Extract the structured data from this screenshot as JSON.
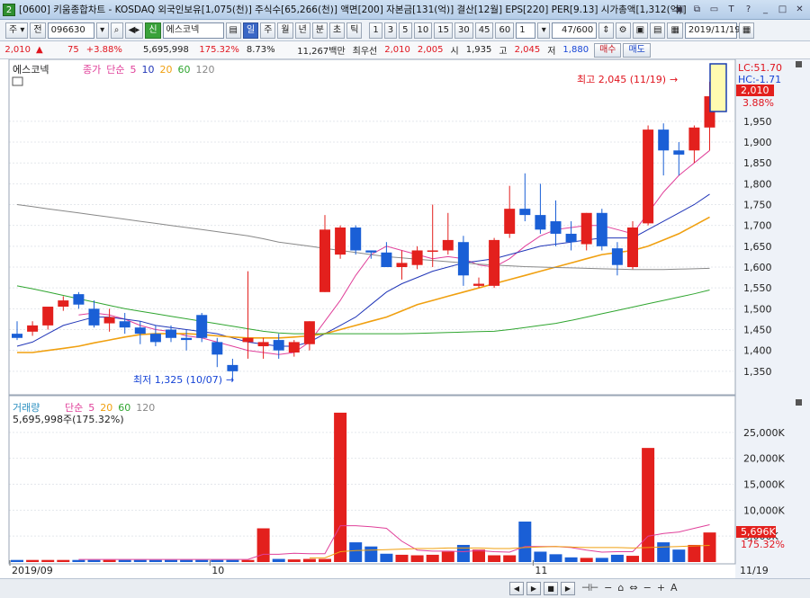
{
  "window": {
    "badge": "2",
    "title": "[0600] 키움종합차트 - KOSDAQ 외국인보유[1,075(천)] 주식수[65,266(천)] 액면[200] 자본금[131(억)] 결산[12월] EPS[220] PER[9.13] 시가총액[1,312(억)]",
    "controls": [
      "▣",
      "⧉",
      "▭",
      "T",
      "?",
      "_",
      "□",
      "✕"
    ]
  },
  "toolbar": {
    "period_select": "주",
    "prev_label": "전",
    "code": "096630",
    "stock_name": "에스코넥",
    "badge_label": "신",
    "period_tabs": [
      "일",
      "주",
      "월",
      "년",
      "분",
      "초",
      "틱"
    ],
    "active_tab": "일",
    "interval_tabs": [
      "1",
      "3",
      "5",
      "10",
      "15",
      "30",
      "45",
      "60"
    ],
    "interval_value": "1",
    "count": "47",
    "count_total": "/600",
    "date": "2019/11/19"
  },
  "quote": {
    "price": "2,010",
    "change_arrow": "▲",
    "change": "75",
    "change_pct": "+3.88%",
    "volume": "5,695,998",
    "volume_ratio": "175.32%",
    "turnover": "8.73%",
    "amount": "11,267백만",
    "best_ask_label": "최우선",
    "best_ask": "2,010",
    "best_bid": "2,005",
    "open_label": "시",
    "open": "1,935",
    "high_label": "고",
    "high": "2,045",
    "low_label": "저",
    "low": "1,880",
    "buy_label": "매수",
    "sell_label": "매도"
  },
  "bottombar": {
    "nav": [
      "◀",
      "▶",
      "■",
      "▶"
    ],
    "tools": [
      "⊣⊢",
      "−",
      "⌂",
      "⇔",
      "−",
      "+",
      "A"
    ]
  },
  "colors": {
    "up": "#e3201d",
    "down": "#1a5fd6",
    "ma5": "#e0409a",
    "ma10": "#2136b8",
    "ma20": "#f0a010",
    "ma60": "#2fa52f",
    "ma120": "#888888"
  },
  "chart_data": {
    "type": "candlestick",
    "price_panel": {
      "legend_name": "에스코넥",
      "legend_items": [
        "종가",
        "단순",
        "5",
        "10",
        "20",
        "60",
        "120"
      ],
      "y_ticks": [
        1350,
        1400,
        1450,
        1500,
        1550,
        1600,
        1650,
        1700,
        1750,
        1800,
        1850,
        1900,
        1950
      ],
      "ylim": [
        1300,
        2090
      ],
      "lc_label": "LC:51.70",
      "hc_label": "HC:-1.71",
      "last_price": "2,010",
      "last_change_pct": "3.88%",
      "max_annotation": "최고 2,045 (11/19)",
      "min_annotation": "최저 1,325 (10/07)",
      "candles": [
        {
          "o": 1440,
          "h": 1470,
          "l": 1425,
          "c": 1430
        },
        {
          "o": 1445,
          "h": 1470,
          "l": 1435,
          "c": 1460
        },
        {
          "o": 1460,
          "h": 1500,
          "l": 1450,
          "c": 1505
        },
        {
          "o": 1505,
          "h": 1530,
          "l": 1495,
          "c": 1520
        },
        {
          "o": 1535,
          "h": 1540,
          "l": 1500,
          "c": 1510
        },
        {
          "o": 1500,
          "h": 1520,
          "l": 1455,
          "c": 1460
        },
        {
          "o": 1465,
          "h": 1500,
          "l": 1445,
          "c": 1480
        },
        {
          "o": 1470,
          "h": 1490,
          "l": 1440,
          "c": 1455
        },
        {
          "o": 1455,
          "h": 1470,
          "l": 1415,
          "c": 1440
        },
        {
          "o": 1440,
          "h": 1460,
          "l": 1410,
          "c": 1420
        },
        {
          "o": 1450,
          "h": 1460,
          "l": 1420,
          "c": 1430
        },
        {
          "o": 1430,
          "h": 1450,
          "l": 1400,
          "c": 1425
        },
        {
          "o": 1485,
          "h": 1490,
          "l": 1420,
          "c": 1430
        },
        {
          "o": 1420,
          "h": 1430,
          "l": 1360,
          "c": 1390
        },
        {
          "o": 1365,
          "h": 1380,
          "l": 1325,
          "c": 1350
        },
        {
          "o": 1420,
          "h": 1590,
          "l": 1380,
          "c": 1430
        },
        {
          "o": 1410,
          "h": 1430,
          "l": 1380,
          "c": 1420
        },
        {
          "o": 1425,
          "h": 1440,
          "l": 1380,
          "c": 1400
        },
        {
          "o": 1395,
          "h": 1425,
          "l": 1385,
          "c": 1420
        },
        {
          "o": 1415,
          "h": 1470,
          "l": 1400,
          "c": 1470
        },
        {
          "o": 1540,
          "h": 1725,
          "l": 1540,
          "c": 1690
        },
        {
          "o": 1630,
          "h": 1700,
          "l": 1620,
          "c": 1695
        },
        {
          "o": 1695,
          "h": 1700,
          "l": 1630,
          "c": 1640
        },
        {
          "o": 1640,
          "h": 1640,
          "l": 1620,
          "c": 1635
        },
        {
          "o": 1635,
          "h": 1660,
          "l": 1600,
          "c": 1600
        },
        {
          "o": 1600,
          "h": 1640,
          "l": 1570,
          "c": 1610
        },
        {
          "o": 1605,
          "h": 1650,
          "l": 1595,
          "c": 1640
        },
        {
          "o": 1640,
          "h": 1750,
          "l": 1600,
          "c": 1640
        },
        {
          "o": 1640,
          "h": 1730,
          "l": 1630,
          "c": 1665
        },
        {
          "o": 1660,
          "h": 1675,
          "l": 1555,
          "c": 1580
        },
        {
          "o": 1555,
          "h": 1575,
          "l": 1550,
          "c": 1560
        },
        {
          "o": 1555,
          "h": 1670,
          "l": 1550,
          "c": 1665
        },
        {
          "o": 1680,
          "h": 1795,
          "l": 1670,
          "c": 1740
        },
        {
          "o": 1740,
          "h": 1825,
          "l": 1710,
          "c": 1725
        },
        {
          "o": 1725,
          "h": 1800,
          "l": 1680,
          "c": 1690
        },
        {
          "o": 1710,
          "h": 1760,
          "l": 1650,
          "c": 1680
        },
        {
          "o": 1680,
          "h": 1710,
          "l": 1640,
          "c": 1660
        },
        {
          "o": 1655,
          "h": 1730,
          "l": 1640,
          "c": 1730
        },
        {
          "o": 1730,
          "h": 1740,
          "l": 1640,
          "c": 1650
        },
        {
          "o": 1645,
          "h": 1660,
          "l": 1580,
          "c": 1605
        },
        {
          "o": 1600,
          "h": 1710,
          "l": 1595,
          "c": 1695
        },
        {
          "o": 1705,
          "h": 1940,
          "l": 1700,
          "c": 1930
        },
        {
          "o": 1930,
          "h": 1945,
          "l": 1820,
          "c": 1880
        },
        {
          "o": 1880,
          "h": 1900,
          "l": 1820,
          "c": 1870
        },
        {
          "o": 1880,
          "h": 1940,
          "l": 1850,
          "c": 1935
        },
        {
          "o": 1935,
          "h": 2045,
          "l": 1880,
          "c": 2010
        }
      ],
      "ma": [
        {
          "name": "5",
          "values": [
            null,
            null,
            null,
            null,
            1485,
            1490,
            1485,
            1475,
            1460,
            1450,
            1445,
            1435,
            1430,
            1420,
            1410,
            1400,
            1395,
            1390,
            1395,
            1420,
            1470,
            1520,
            1580,
            1630,
            1650,
            1640,
            1630,
            1620,
            1625,
            1620,
            1605,
            1600,
            1620,
            1650,
            1675,
            1690,
            1695,
            1700,
            1700,
            1690,
            1680,
            1730,
            1780,
            1820,
            1850,
            1880
          ]
        },
        {
          "name": "10",
          "values": [
            1410,
            1420,
            1440,
            1460,
            1470,
            1480,
            1480,
            1475,
            1470,
            1460,
            1455,
            1450,
            1445,
            1440,
            1430,
            1420,
            1415,
            1410,
            1410,
            1420,
            1440,
            1460,
            1480,
            1510,
            1540,
            1560,
            1575,
            1590,
            1600,
            1610,
            1615,
            1620,
            1630,
            1640,
            1650,
            1655,
            1660,
            1665,
            1670,
            1670,
            1670,
            1690,
            1710,
            1730,
            1750,
            1775
          ]
        },
        {
          "name": "20",
          "values": [
            1395,
            1395,
            1400,
            1405,
            1410,
            1418,
            1425,
            1432,
            1438,
            1440,
            1440,
            1440,
            1438,
            1435,
            1432,
            1430,
            1430,
            1430,
            1432,
            1435,
            1440,
            1450,
            1460,
            1470,
            1480,
            1495,
            1510,
            1520,
            1530,
            1540,
            1550,
            1560,
            1570,
            1580,
            1590,
            1600,
            1610,
            1620,
            1630,
            1635,
            1640,
            1650,
            1665,
            1680,
            1700,
            1720
          ]
        },
        {
          "name": "60",
          "values": [
            1555,
            1548,
            1540,
            1532,
            1524,
            1516,
            1508,
            1500,
            1494,
            1488,
            1482,
            1476,
            1470,
            1464,
            1458,
            1452,
            1446,
            1442,
            1440,
            1440,
            1440,
            1440,
            1440,
            1440,
            1440,
            1440,
            1441,
            1442,
            1443,
            1444,
            1445,
            1446,
            1450,
            1455,
            1460,
            1465,
            1472,
            1480,
            1488,
            1496,
            1504,
            1512,
            1520,
            1528,
            1536,
            1545
          ]
        },
        {
          "name": "120",
          "values": [
            1750,
            1745,
            1740,
            1735,
            1730,
            1725,
            1720,
            1715,
            1710,
            1705,
            1700,
            1695,
            1690,
            1685,
            1680,
            1675,
            1668,
            1660,
            1655,
            1650,
            1645,
            1640,
            1635,
            1630,
            1625,
            1622,
            1619,
            1616,
            1613,
            1610,
            1607,
            1605,
            1603,
            1601,
            1600,
            1599,
            1598,
            1597,
            1596,
            1595,
            1594,
            1594,
            1594,
            1595,
            1596,
            1597
          ]
        }
      ]
    },
    "volume_panel": {
      "legend_items": [
        "거래량",
        "단순",
        "5",
        "20",
        "60",
        "120"
      ],
      "summary": "5,695,998주(175.32%)",
      "y_ticks": [
        "5,000K",
        "10,000K",
        "15,000K",
        "20,000K",
        "25,000K"
      ],
      "y_tick_values": [
        5000,
        10000,
        15000,
        20000,
        25000
      ],
      "ylim": [
        0,
        30000
      ],
      "last_volume": "5,696K",
      "last_ratio": "175.32%",
      "values": [
        400,
        400,
        400,
        400,
        400,
        400,
        400,
        400,
        400,
        400,
        400,
        400,
        400,
        400,
        400,
        400,
        6500,
        600,
        500,
        600,
        600,
        28800,
        3800,
        3000,
        1600,
        1400,
        1300,
        1400,
        2000,
        3300,
        2400,
        1300,
        1300,
        7800,
        2000,
        1500,
        900,
        800,
        800,
        1400,
        1200,
        22000,
        3800,
        2400,
        3300,
        5700
      ],
      "ma5": [
        null,
        null,
        null,
        null,
        500,
        500,
        500,
        500,
        500,
        500,
        500,
        500,
        500,
        500,
        500,
        500,
        1500,
        1500,
        1700,
        1600,
        1600,
        7000,
        7000,
        6800,
        6500,
        4000,
        2300,
        2100,
        2100,
        2000,
        2200,
        2000,
        1900,
        3000,
        3000,
        3000,
        2800,
        2300,
        1900,
        2000,
        2000,
        5000,
        5500,
        5800,
        6500,
        7200
      ],
      "ma20": [
        null,
        null,
        null,
        null,
        null,
        null,
        null,
        null,
        null,
        null,
        null,
        null,
        null,
        null,
        null,
        null,
        null,
        null,
        null,
        800,
        800,
        2000,
        2200,
        2300,
        2400,
        2500,
        2600,
        2600,
        2700,
        2700,
        2700,
        2600,
        2600,
        2800,
        2900,
        3000,
        2900,
        2800,
        2800,
        2800,
        2700,
        2800,
        2900,
        3000,
        3100,
        3200
      ]
    },
    "x_labels": [
      {
        "label": "2019/09",
        "index": 0
      },
      {
        "label": "10",
        "index": 13
      },
      {
        "label": "11",
        "index": 34
      }
    ],
    "x_end_label": "11/19"
  }
}
